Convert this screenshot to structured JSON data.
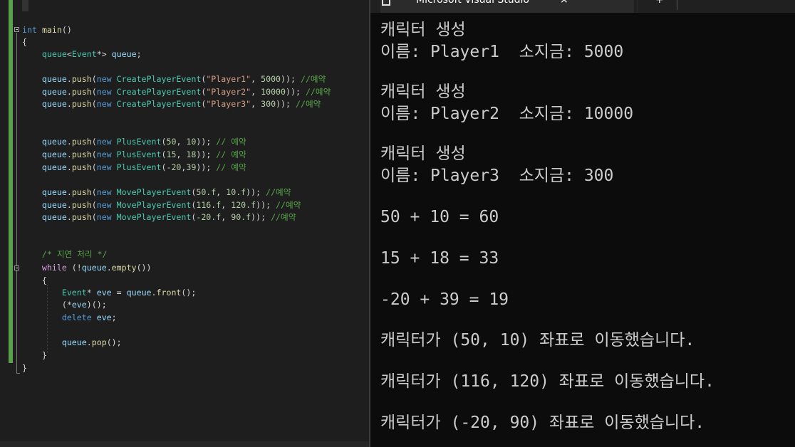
{
  "editor": {
    "lines": [
      [
        [
          "kw",
          "int"
        ],
        [
          "pn",
          " "
        ],
        [
          "fn",
          "main"
        ],
        [
          "pn",
          "()"
        ]
      ],
      [
        [
          "pn",
          "{"
        ]
      ],
      [
        [
          "pn",
          "    "
        ],
        [
          "ty",
          "queue"
        ],
        [
          "pn",
          "<"
        ],
        [
          "ty",
          "Event"
        ],
        [
          "pn",
          "*> "
        ],
        [
          "var",
          "queue"
        ],
        [
          "pn",
          ";"
        ]
      ],
      [],
      [
        [
          "pn",
          "    "
        ],
        [
          "var",
          "queue"
        ],
        [
          "pn",
          "."
        ],
        [
          "fn",
          "push"
        ],
        [
          "pn",
          "("
        ],
        [
          "kw",
          "new"
        ],
        [
          "pn",
          " "
        ],
        [
          "ty",
          "CreatePlayerEvent"
        ],
        [
          "pn",
          "("
        ],
        [
          "str",
          "\"Player1\""
        ],
        [
          "pn",
          ", "
        ],
        [
          "num",
          "5000"
        ],
        [
          "pn",
          "));"
        ],
        [
          "cm",
          " //예약"
        ]
      ],
      [
        [
          "pn",
          "    "
        ],
        [
          "var",
          "queue"
        ],
        [
          "pn",
          "."
        ],
        [
          "fn",
          "push"
        ],
        [
          "pn",
          "("
        ],
        [
          "kw",
          "new"
        ],
        [
          "pn",
          " "
        ],
        [
          "ty",
          "CreatePlayerEvent"
        ],
        [
          "pn",
          "("
        ],
        [
          "str",
          "\"Player2\""
        ],
        [
          "pn",
          ", "
        ],
        [
          "num",
          "10000"
        ],
        [
          "pn",
          "));"
        ],
        [
          "cm",
          " //예약"
        ]
      ],
      [
        [
          "pn",
          "    "
        ],
        [
          "var",
          "queue"
        ],
        [
          "pn",
          "."
        ],
        [
          "fn",
          "push"
        ],
        [
          "pn",
          "("
        ],
        [
          "kw",
          "new"
        ],
        [
          "pn",
          " "
        ],
        [
          "ty",
          "CreatePlayerEvent"
        ],
        [
          "pn",
          "("
        ],
        [
          "str",
          "\"Player3\""
        ],
        [
          "pn",
          ", "
        ],
        [
          "num",
          "300"
        ],
        [
          "pn",
          "));"
        ],
        [
          "cm",
          " //예약"
        ]
      ],
      [],
      [],
      [
        [
          "pn",
          "    "
        ],
        [
          "var",
          "queue"
        ],
        [
          "pn",
          "."
        ],
        [
          "fn",
          "push"
        ],
        [
          "pn",
          "("
        ],
        [
          "kw",
          "new"
        ],
        [
          "pn",
          " "
        ],
        [
          "ty",
          "PlusEvent"
        ],
        [
          "pn",
          "("
        ],
        [
          "num",
          "50"
        ],
        [
          "pn",
          ", "
        ],
        [
          "num",
          "10"
        ],
        [
          "pn",
          "));"
        ],
        [
          "cm",
          " // 예약"
        ]
      ],
      [
        [
          "pn",
          "    "
        ],
        [
          "var",
          "queue"
        ],
        [
          "pn",
          "."
        ],
        [
          "fn",
          "push"
        ],
        [
          "pn",
          "("
        ],
        [
          "kw",
          "new"
        ],
        [
          "pn",
          " "
        ],
        [
          "ty",
          "PlusEvent"
        ],
        [
          "pn",
          "("
        ],
        [
          "num",
          "15"
        ],
        [
          "pn",
          ", "
        ],
        [
          "num",
          "18"
        ],
        [
          "pn",
          "));"
        ],
        [
          "cm",
          " // 예약"
        ]
      ],
      [
        [
          "pn",
          "    "
        ],
        [
          "var",
          "queue"
        ],
        [
          "pn",
          "."
        ],
        [
          "fn",
          "push"
        ],
        [
          "pn",
          "("
        ],
        [
          "kw",
          "new"
        ],
        [
          "pn",
          " "
        ],
        [
          "ty",
          "PlusEvent"
        ],
        [
          "pn",
          "("
        ],
        [
          "num",
          "-20"
        ],
        [
          "pn",
          ","
        ],
        [
          "num",
          "39"
        ],
        [
          "pn",
          "));"
        ],
        [
          "cm",
          " // 예약"
        ]
      ],
      [],
      [
        [
          "pn",
          "    "
        ],
        [
          "var",
          "queue"
        ],
        [
          "pn",
          "."
        ],
        [
          "fn",
          "push"
        ],
        [
          "pn",
          "("
        ],
        [
          "kw",
          "new"
        ],
        [
          "pn",
          " "
        ],
        [
          "ty",
          "MovePlayerEvent"
        ],
        [
          "pn",
          "("
        ],
        [
          "num",
          "50.f"
        ],
        [
          "pn",
          ", "
        ],
        [
          "num",
          "10.f"
        ],
        [
          "pn",
          "));"
        ],
        [
          "cm",
          " //예약"
        ]
      ],
      [
        [
          "pn",
          "    "
        ],
        [
          "var",
          "queue"
        ],
        [
          "pn",
          "."
        ],
        [
          "fn",
          "push"
        ],
        [
          "pn",
          "("
        ],
        [
          "kw",
          "new"
        ],
        [
          "pn",
          " "
        ],
        [
          "ty",
          "MovePlayerEvent"
        ],
        [
          "pn",
          "("
        ],
        [
          "num",
          "116.f"
        ],
        [
          "pn",
          ", "
        ],
        [
          "num",
          "120.f"
        ],
        [
          "pn",
          "));"
        ],
        [
          "cm",
          " //예약"
        ]
      ],
      [
        [
          "pn",
          "    "
        ],
        [
          "var",
          "queue"
        ],
        [
          "pn",
          "."
        ],
        [
          "fn",
          "push"
        ],
        [
          "pn",
          "("
        ],
        [
          "kw",
          "new"
        ],
        [
          "pn",
          " "
        ],
        [
          "ty",
          "MovePlayerEvent"
        ],
        [
          "pn",
          "("
        ],
        [
          "num",
          "-20.f"
        ],
        [
          "pn",
          ", "
        ],
        [
          "num",
          "90.f"
        ],
        [
          "pn",
          "));"
        ],
        [
          "cm",
          " //예약"
        ]
      ],
      [],
      [],
      [
        [
          "cm",
          "    /* 지연 처리 */"
        ]
      ],
      [
        [
          "pn",
          "    "
        ],
        [
          "ctl",
          "while"
        ],
        [
          "pn",
          " (!"
        ],
        [
          "var",
          "queue"
        ],
        [
          "pn",
          "."
        ],
        [
          "fn",
          "empty"
        ],
        [
          "pn",
          "())"
        ]
      ],
      [
        [
          "pn",
          "    {"
        ]
      ],
      [
        [
          "pn",
          "        "
        ],
        [
          "ty",
          "Event"
        ],
        [
          "pn",
          "* "
        ],
        [
          "var",
          "eve"
        ],
        [
          "pn",
          " = "
        ],
        [
          "var",
          "queue"
        ],
        [
          "pn",
          "."
        ],
        [
          "fn",
          "front"
        ],
        [
          "pn",
          "();"
        ]
      ],
      [
        [
          "pn",
          "        (*"
        ],
        [
          "var",
          "eve"
        ],
        [
          "pn",
          ")();"
        ]
      ],
      [
        [
          "pn",
          "        "
        ],
        [
          "kw",
          "delete"
        ],
        [
          "pn",
          " "
        ],
        [
          "var",
          "eve"
        ],
        [
          "pn",
          ";"
        ]
      ],
      [],
      [
        [
          "pn",
          "        "
        ],
        [
          "var",
          "queue"
        ],
        [
          "pn",
          "."
        ],
        [
          "fn",
          "pop"
        ],
        [
          "pn",
          "();"
        ]
      ],
      [
        [
          "pn",
          "    }"
        ]
      ],
      [
        [
          "pn",
          "}"
        ]
      ]
    ]
  },
  "console": {
    "title": "Microsoft Visual Studio",
    "close_glyph": "×",
    "new_tab_glyph": "+",
    "output": [
      "캐릭터 생성",
      "이름: Player1  소지금: 5000",
      "",
      "캐릭터 생성",
      "이름: Player2  소지금: 10000",
      "",
      "캐릭터 생성",
      "이름: Player3  소지금: 300",
      "",
      "50 + 10 = 60",
      "",
      "15 + 18 = 33",
      "",
      "-20 + 39 = 19",
      "",
      "캐릭터가 (50, 10) 좌표로 이동했습니다.",
      "",
      "캐릭터가 (116, 120) 좌표로 이동했습니다.",
      "",
      "캐릭터가 (-20, 90) 좌표로 이동했습니다."
    ]
  },
  "colors": {
    "keyword": "#569cd6",
    "control": "#d8a0df",
    "type": "#4ec9b0",
    "function": "#dcdcaa",
    "variable": "#9cdcfe",
    "string": "#d69d85",
    "number": "#b5cea8",
    "comment": "#57a64a",
    "change_bar": "#58a14a"
  }
}
